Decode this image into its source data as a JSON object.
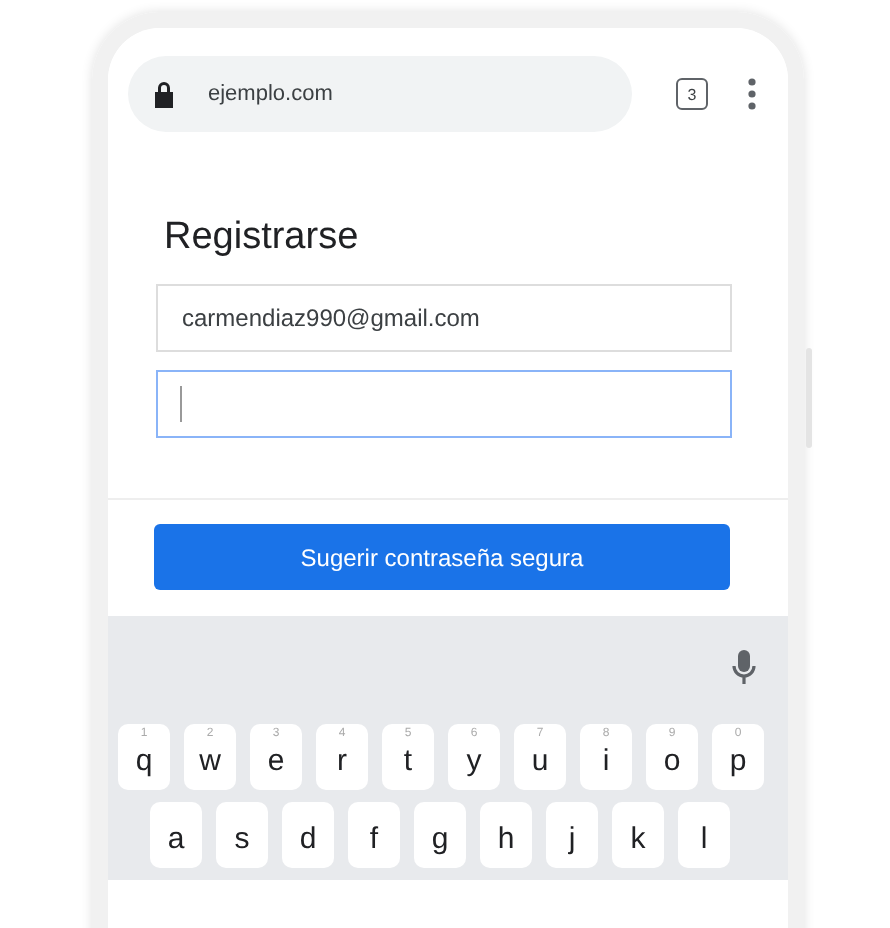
{
  "browser": {
    "url": "ejemplo.com",
    "tab_count": "3"
  },
  "form": {
    "title": "Registrarse",
    "email": {
      "value": "carmendiaz990@gmail.com",
      "focused": false
    },
    "password": {
      "focused": true
    }
  },
  "suggest_button": "Sugerir contraseña segura",
  "keyboard": {
    "rows": [
      [
        {
          "key": "q",
          "hint": "1"
        },
        {
          "key": "w",
          "hint": "2"
        },
        {
          "key": "e",
          "hint": "3"
        },
        {
          "key": "r",
          "hint": "4"
        },
        {
          "key": "t",
          "hint": "5"
        },
        {
          "key": "y",
          "hint": "6"
        },
        {
          "key": "u",
          "hint": "7"
        },
        {
          "key": "i",
          "hint": "8"
        },
        {
          "key": "o",
          "hint": "9"
        },
        {
          "key": "p",
          "hint": "0"
        }
      ],
      [
        {
          "key": "a"
        },
        {
          "key": "s"
        },
        {
          "key": "d"
        },
        {
          "key": "f"
        },
        {
          "key": "g"
        },
        {
          "key": "h"
        },
        {
          "key": "j"
        },
        {
          "key": "k"
        },
        {
          "key": "l"
        }
      ]
    ]
  }
}
